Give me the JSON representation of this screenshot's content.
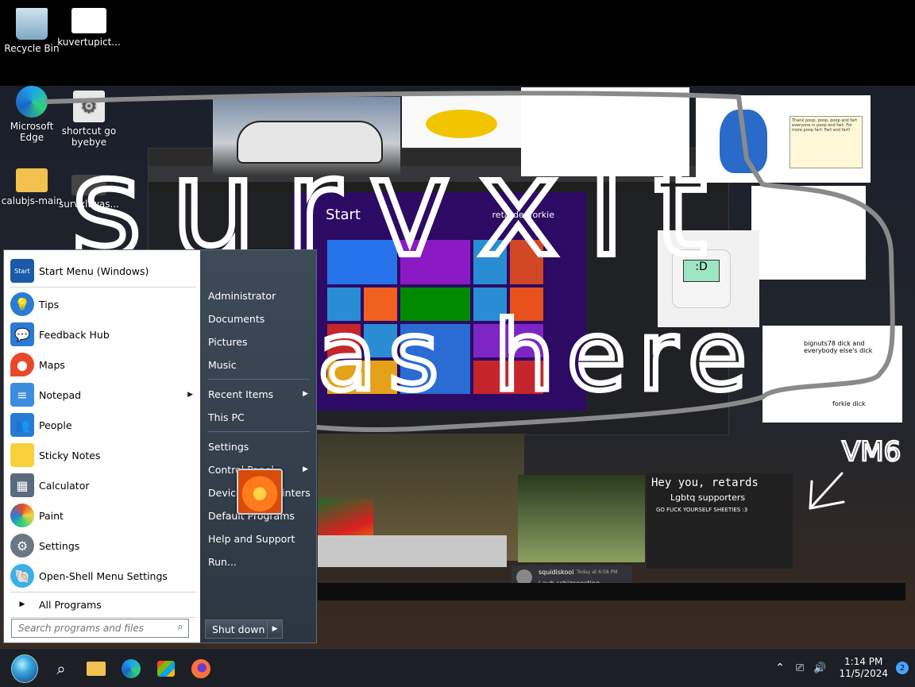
{
  "desktop": {
    "icons": [
      {
        "label": "Recycle Bin"
      },
      {
        "label": "kuvertupict..."
      },
      {
        "label": "Microsoft Edge"
      },
      {
        "label": "shortcut go byebye"
      },
      {
        "label": "calubjs-main"
      },
      {
        "label": "survxltwas..."
      }
    ],
    "doodle_text": [
      "survxlt",
      "as here",
      "VM6"
    ],
    "collage": {
      "start_screen_title": "Start",
      "start_screen_user": "retardedforkie",
      "forkie_caption": "bignuts78 dick and everybody else's dick",
      "forkie_label": "forkie dick",
      "sign_heading": "Hey you, retards",
      "sign_sub": "Lgbtq supporters",
      "sign_line": "GO FUCK YOURSELF SHEETIES :3",
      "chat_user": "squidiskool",
      "chat_time": "Today at 6:58 PM",
      "chat_msg": "i aub schizoposting",
      "monitor_face": ":D",
      "note_text": "Thank poop, poop, poop and fart everyone in poop and fart. For more poop fart: Fart and fart!"
    }
  },
  "start_menu": {
    "header_label": "Start Menu (Windows)",
    "header_badge": "Start",
    "programs": [
      {
        "label": "Tips",
        "icon": "tips-icon"
      },
      {
        "label": "Feedback Hub",
        "icon": "feedback-hub-icon"
      },
      {
        "label": "Maps",
        "icon": "maps-icon"
      },
      {
        "label": "Notepad",
        "icon": "notepad-icon",
        "has_submenu": true
      },
      {
        "label": "People",
        "icon": "people-icon"
      },
      {
        "label": "Sticky Notes",
        "icon": "sticky-notes-icon"
      },
      {
        "label": "Calculator",
        "icon": "calculator-icon"
      },
      {
        "label": "Paint",
        "icon": "paint-icon"
      },
      {
        "label": "Settings",
        "icon": "settings-icon"
      },
      {
        "label": "Open-Shell Menu Settings",
        "icon": "open-shell-icon"
      }
    ],
    "all_programs": "All Programs",
    "search_placeholder": "Search programs and files",
    "right": {
      "user": "Administrator",
      "items": [
        {
          "label": "Documents"
        },
        {
          "label": "Pictures"
        },
        {
          "label": "Music"
        },
        {
          "label": "Recent Items"
        },
        {
          "label": "This PC"
        },
        {
          "label": "Settings"
        },
        {
          "label": "Control Panel"
        },
        {
          "label": "Devices and Printers"
        },
        {
          "label": "Default Programs"
        },
        {
          "label": "Help and Support"
        },
        {
          "label": "Run..."
        }
      ]
    },
    "shutdown_label": "Shut down"
  },
  "taskbar": {
    "time": "1:14 PM",
    "date": "11/5/2024",
    "notification_count": "2"
  },
  "colors": {
    "accent": "#4aa3ff",
    "menu_right_bg": "#34404c",
    "taskbar_bg": "#1c1f25"
  }
}
